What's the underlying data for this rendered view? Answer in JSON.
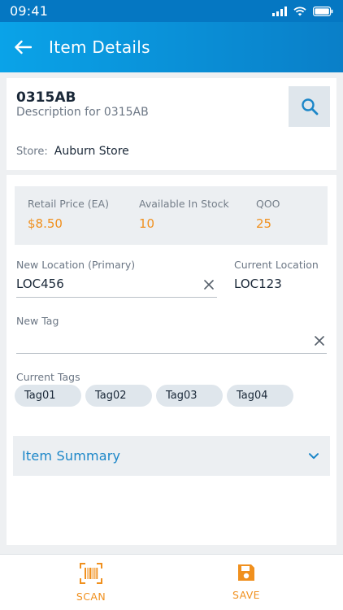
{
  "status_bar": {
    "time": "09:41"
  },
  "header": {
    "title": "Item Details"
  },
  "item": {
    "code": "0315AB",
    "description": "Description for 0315AB"
  },
  "store": {
    "label": "Store:",
    "value": "Auburn Store"
  },
  "stats": [
    {
      "label": "Retail Price (EA)",
      "value": "$8.50"
    },
    {
      "label": "Available In Stock",
      "value": "10"
    },
    {
      "label": "QOO",
      "value": "25"
    }
  ],
  "location": {
    "new_label": "New Location (Primary)",
    "new_value": "LOC456",
    "current_label": "Current Location",
    "current_value": "LOC123"
  },
  "new_tag": {
    "label": "New Tag",
    "value": ""
  },
  "current_tags": {
    "label": "Current Tags",
    "tags": [
      "Tag01",
      "Tag02",
      "Tag03",
      "Tag04"
    ]
  },
  "summary": {
    "title": "Item Summary"
  },
  "bottom_bar": {
    "scan_label": "SCAN",
    "save_label": "SAVE"
  },
  "colors": {
    "header_start": "#0aa3e8",
    "header_end": "#0a7fc8",
    "accent": "#f0901e",
    "link": "#1b86c8"
  },
  "icons": [
    "back-arrow-icon",
    "search-icon",
    "clear-icon",
    "chevron-down-icon",
    "barcode-scan-icon",
    "save-icon"
  ]
}
